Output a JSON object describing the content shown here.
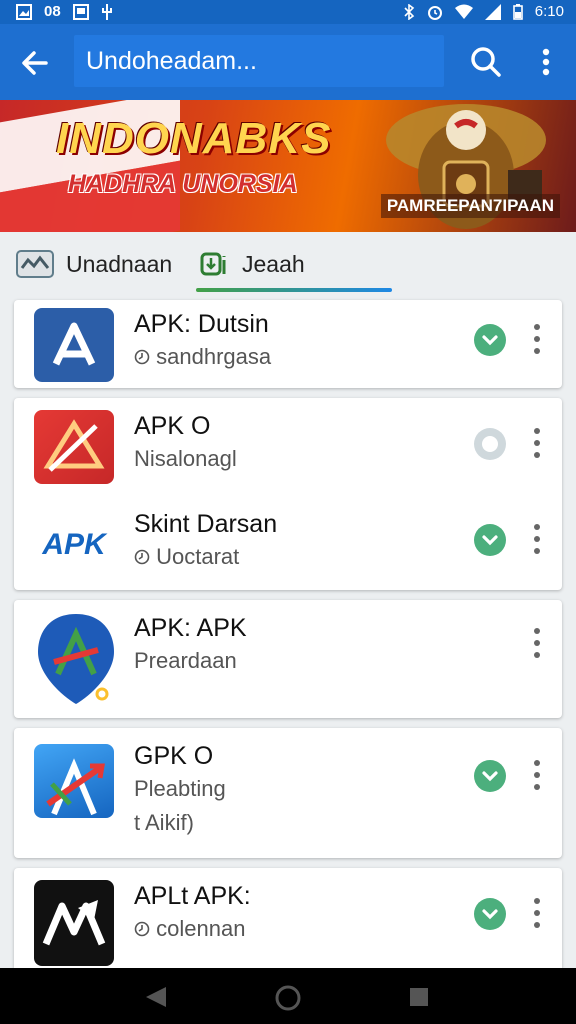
{
  "status_bar": {
    "left_text": "08",
    "time": "6:10"
  },
  "app_bar": {
    "search_text": "Undoheadam..."
  },
  "banner": {
    "title": "INDONABKS",
    "subtitle": "HADHRA UNORSIA",
    "caption": "PAMREEPAN7IPAAN"
  },
  "tabs": [
    {
      "label": "Unadnaan",
      "icon": "image-icon",
      "active": false
    },
    {
      "label": "Jeaah",
      "icon": "download-icon",
      "prefix": "ⓓiŋ",
      "active": true
    }
  ],
  "apps": [
    {
      "name": "APK: Dutsin",
      "sub": "sandhrgasa",
      "sub_icon": "clock-icon",
      "status": "installed",
      "icon": "apk-blue-a-icon"
    },
    {
      "name": "APK O",
      "sub": "Nisalonagl",
      "status": "not-installed",
      "icon": "apk-red-triangle-icon"
    },
    {
      "name": "Skint Darsan",
      "sub": "Uoctarat",
      "sub_icon": "clock-icon",
      "status": "installed",
      "icon": "apk-text-icon",
      "icon_text": "APK"
    },
    {
      "name": "APK: APK",
      "sub": "Preardaan",
      "status": "none",
      "icon": "apk-pin-icon"
    },
    {
      "name": "GPK O",
      "sub": "Pleabting",
      "sub2": "t Aikif)",
      "status": "installed",
      "icon": "apk-blue-arrow-icon"
    },
    {
      "name": "APLt APK:",
      "sub": "colennan",
      "sub_icon": "clock-icon",
      "status": "installed",
      "icon": "apk-black-icon"
    }
  ],
  "colors": {
    "app_bar": "#1e6fd0",
    "status_bar": "#1565c0",
    "accent_green": "#4caf7d",
    "background": "#eceff1"
  }
}
